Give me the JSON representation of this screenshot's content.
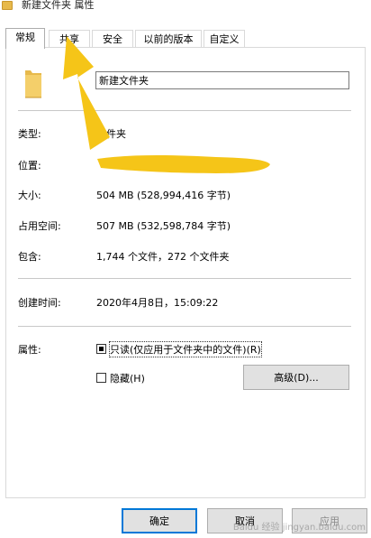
{
  "window": {
    "title": "新建文件夹 属性"
  },
  "tabs": [
    "常规",
    "共享",
    "安全",
    "以前的版本",
    "自定义"
  ],
  "general": {
    "name": "新建文件夹",
    "type_label": "类型:",
    "type_value": "文件夹",
    "location_label": "位置:",
    "size_label": "大小:",
    "size_value": "504 MB (528,994,416 字节)",
    "disk_label": "占用空间:",
    "disk_value": "507 MB (532,598,784 字节)",
    "contains_label": "包含:",
    "contains_value": "1,744 个文件，272 个文件夹",
    "created_label": "创建时间:",
    "created_value": "2020年4月8日，15:09:22",
    "attributes_label": "属性:",
    "readonly_label": "只读(仅应用于文件夹中的文件)(R)",
    "hidden_label": "隐藏(H)",
    "advanced_button": "高级(D)..."
  },
  "buttons": {
    "ok": "确定",
    "cancel": "取消",
    "apply": "应用"
  },
  "watermark": "Baidu 经验 jingyan.baidu.com",
  "colors": {
    "annotation_yellow": "#f5c518",
    "accent_blue": "#0078d7",
    "folder": "#e7b94b"
  },
  "icons": {
    "folder": "folder-icon",
    "arrow": "arrow-annotation"
  }
}
